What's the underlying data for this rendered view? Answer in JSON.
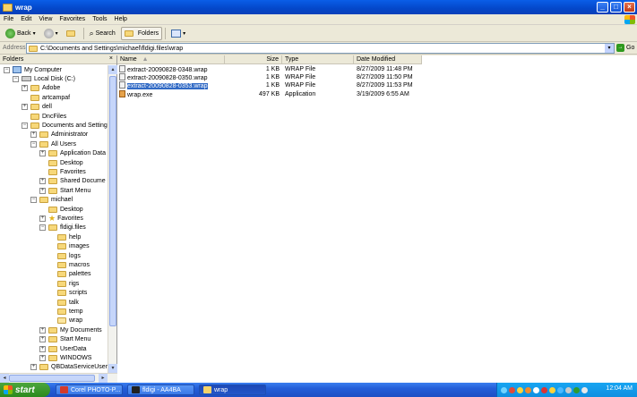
{
  "window": {
    "title": "wrap"
  },
  "menu": [
    "File",
    "Edit",
    "View",
    "Favorites",
    "Tools",
    "Help"
  ],
  "toolbar": {
    "back": "Back",
    "search": "Search",
    "folders": "Folders"
  },
  "address": {
    "label": "Address",
    "path": "C:\\Documents and Settings\\michael\\fldigi.files\\wrap",
    "go": "Go"
  },
  "folders_pane": {
    "title": "Folders",
    "tree": [
      {
        "label": "My Computer",
        "level": 0,
        "toggle": "−",
        "icon": "computer-icon"
      },
      {
        "label": "Local Disk (C:)",
        "level": 1,
        "toggle": "−",
        "icon": "drive-icon"
      },
      {
        "label": "Adobe",
        "level": 2,
        "toggle": "+",
        "icon": "folder-icon"
      },
      {
        "label": "artcampaf",
        "level": 2,
        "toggle": "",
        "icon": "folder-icon"
      },
      {
        "label": "dell",
        "level": 2,
        "toggle": "+",
        "icon": "folder-icon"
      },
      {
        "label": "DncFiles",
        "level": 2,
        "toggle": "",
        "icon": "folder-icon"
      },
      {
        "label": "Documents and Setting",
        "level": 2,
        "toggle": "−",
        "icon": "folder-icon"
      },
      {
        "label": "Administrator",
        "level": 3,
        "toggle": "+",
        "icon": "folder-icon"
      },
      {
        "label": "All Users",
        "level": 3,
        "toggle": "−",
        "icon": "folder-icon"
      },
      {
        "label": "Application Data",
        "level": 4,
        "toggle": "+",
        "icon": "folder-icon"
      },
      {
        "label": "Desktop",
        "level": 4,
        "toggle": "",
        "icon": "folder-icon"
      },
      {
        "label": "Favorites",
        "level": 4,
        "toggle": "",
        "icon": "folder-icon"
      },
      {
        "label": "Shared Docume",
        "level": 4,
        "toggle": "+",
        "icon": "folder-icon"
      },
      {
        "label": "Start Menu",
        "level": 4,
        "toggle": "+",
        "icon": "folder-icon"
      },
      {
        "label": "michael",
        "level": 3,
        "toggle": "−",
        "icon": "folder-icon"
      },
      {
        "label": "Desktop",
        "level": 4,
        "toggle": "",
        "icon": "folder-icon"
      },
      {
        "label": "Favorites",
        "level": 4,
        "toggle": "+",
        "icon": "star-icon"
      },
      {
        "label": "fldigi.files",
        "level": 4,
        "toggle": "−",
        "icon": "folder-icon"
      },
      {
        "label": "help",
        "level": 5,
        "toggle": "",
        "icon": "folder-icon"
      },
      {
        "label": "images",
        "level": 5,
        "toggle": "",
        "icon": "folder-icon"
      },
      {
        "label": "logs",
        "level": 5,
        "toggle": "",
        "icon": "folder-icon"
      },
      {
        "label": "macros",
        "level": 5,
        "toggle": "",
        "icon": "folder-icon"
      },
      {
        "label": "palettes",
        "level": 5,
        "toggle": "",
        "icon": "folder-icon"
      },
      {
        "label": "rigs",
        "level": 5,
        "toggle": "",
        "icon": "folder-icon"
      },
      {
        "label": "scripts",
        "level": 5,
        "toggle": "",
        "icon": "folder-icon"
      },
      {
        "label": "talk",
        "level": 5,
        "toggle": "",
        "icon": "folder-icon"
      },
      {
        "label": "temp",
        "level": 5,
        "toggle": "",
        "icon": "folder-icon"
      },
      {
        "label": "wrap",
        "level": 5,
        "toggle": "",
        "icon": "folder-open-icon"
      },
      {
        "label": "My Documents",
        "level": 4,
        "toggle": "+",
        "icon": "folder-icon"
      },
      {
        "label": "Start Menu",
        "level": 4,
        "toggle": "+",
        "icon": "folder-icon"
      },
      {
        "label": "UserData",
        "level": 4,
        "toggle": "+",
        "icon": "folder-icon"
      },
      {
        "label": "WINDOWS",
        "level": 4,
        "toggle": "+",
        "icon": "folder-icon"
      },
      {
        "label": "QBDataServiceUser:",
        "level": 3,
        "toggle": "+",
        "icon": "folder-icon"
      }
    ]
  },
  "file_list": {
    "columns": [
      "Name",
      "Size",
      "Type",
      "Date Modified"
    ],
    "rows": [
      {
        "name": "extract-20090828-0348.wrap",
        "size": "1 KB",
        "type": "WRAP File",
        "date": "8/27/2009 11:48 PM",
        "icon": "file-icon",
        "selected": false
      },
      {
        "name": "extract-20090828-0350.wrap",
        "size": "1 KB",
        "type": "WRAP File",
        "date": "8/27/2009 11:50 PM",
        "icon": "file-icon",
        "selected": false
      },
      {
        "name": "extract-20090828-0353.wrap",
        "size": "1 KB",
        "type": "WRAP File",
        "date": "8/27/2009 11:53 PM",
        "icon": "file-icon",
        "selected": true
      },
      {
        "name": "wrap.exe",
        "size": "497 KB",
        "type": "Application",
        "date": "3/19/2009 6:55 AM",
        "icon": "exe-icon",
        "selected": false
      }
    ]
  },
  "taskbar": {
    "start": "start",
    "tasks": [
      {
        "label": "Corel PHOTO-P...",
        "active": false
      },
      {
        "label": "fldigi - AA4BA",
        "active": false
      },
      {
        "label": "wrap",
        "active": true
      }
    ],
    "clock": "12:04 AM"
  }
}
